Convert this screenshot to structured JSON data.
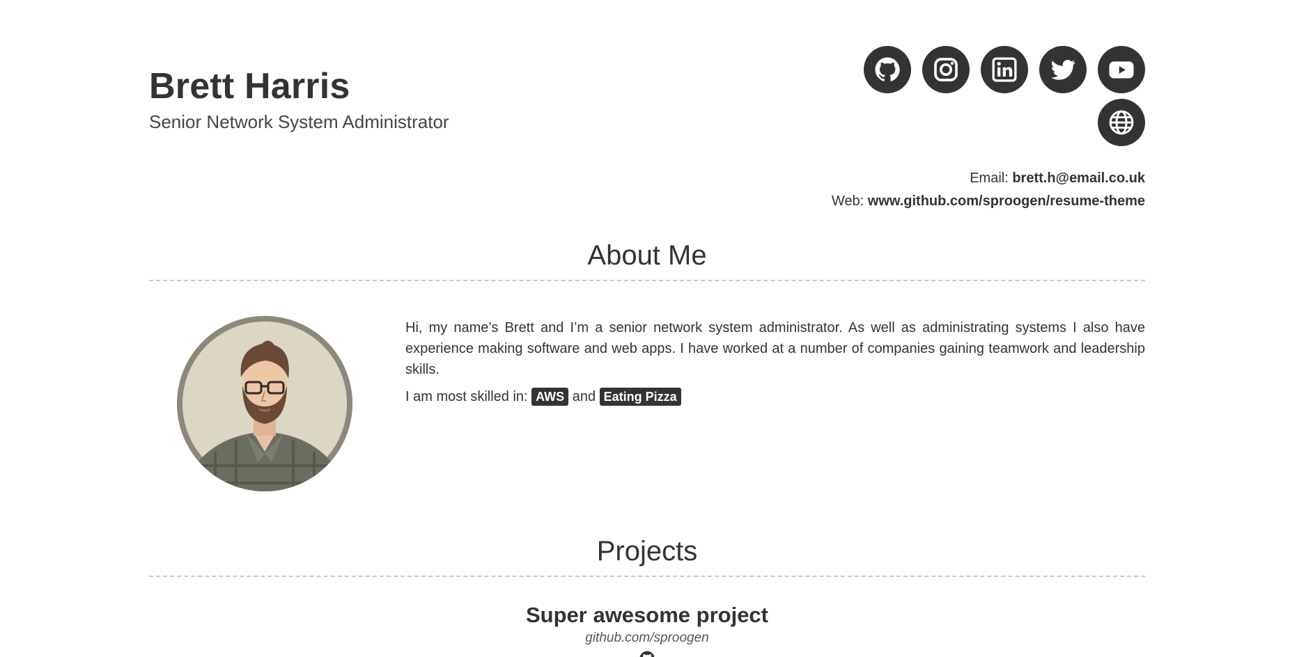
{
  "header": {
    "name": "Brett Harris",
    "title": "Senior Network System Administrator"
  },
  "social": [
    {
      "name": "github",
      "icon": "github-icon"
    },
    {
      "name": "instagram",
      "icon": "instagram-icon"
    },
    {
      "name": "linkedin",
      "icon": "linkedin-icon"
    },
    {
      "name": "twitter",
      "icon": "twitter-icon"
    },
    {
      "name": "youtube",
      "icon": "youtube-icon"
    },
    {
      "name": "website",
      "icon": "globe-icon"
    }
  ],
  "contact": {
    "email_label": "Email: ",
    "email": "brett.h@email.co.uk",
    "web_label": "Web: ",
    "web": "www.github.com/sproogen/resume-theme"
  },
  "about": {
    "heading": "About Me",
    "text": "Hi, my name’s Brett and I’m a senior network system administrator. As well as administrating systems I also have experience making software and web apps. I have worked at a number of companies gaining teamwork and leadership skills.",
    "skills_prefix": "I am most skilled in: ",
    "skill_1": "AWS",
    "skills_and": " and ",
    "skill_2": "Eating Pizza"
  },
  "projects": {
    "heading": "Projects",
    "items": [
      {
        "title": "Super awesome project",
        "link": "github.com/sproogen",
        "icon": "github-icon"
      }
    ]
  },
  "colors": {
    "text": "#333333",
    "icon_bg": "#333333",
    "divider": "#c8c8c8",
    "background": "#ffffff"
  }
}
